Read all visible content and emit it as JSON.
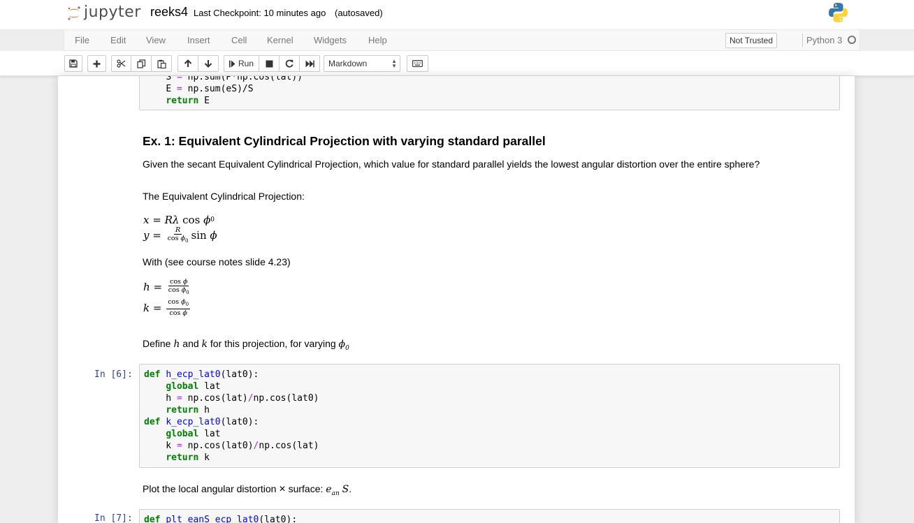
{
  "header": {
    "logo_text": "jupyter",
    "notebook_name": "reeks4",
    "checkpoint": "Last Checkpoint: 10 minutes ago",
    "autosave": "(autosaved)",
    "python_logo_icon": "python-logo-icon"
  },
  "menubar": {
    "items": [
      "File",
      "Edit",
      "View",
      "Insert",
      "Cell",
      "Kernel",
      "Widgets",
      "Help"
    ],
    "trust_label": "Not Trusted",
    "kernel_name": "Python 3",
    "kernel_indicator_icon": "kernel-idle-circle-icon"
  },
  "toolbar": {
    "run_label": "Run",
    "cell_type": "Markdown",
    "icons": [
      "save-icon",
      "plus-icon",
      "scissors-icon",
      "copy-icon",
      "paste-icon",
      "arrow-up-icon",
      "arrow-down-icon",
      "run-icon",
      "stop-icon",
      "restart-icon",
      "fast-forward-icon",
      "keyboard-icon"
    ]
  },
  "cells": {
    "top_code_tail": [
      {
        "var": "S",
        "expr": "np.sum(P*np.cos(lat))"
      },
      {
        "var": "E",
        "expr": "np.sum(eS)/S"
      },
      {
        "kw": "return",
        "rest": "E"
      }
    ],
    "ex1_heading": "Ex. 1: Equivalent Cylindrical Projection with varying standard parallel",
    "ex1_question": "Given the secant Equivalent Cylindrical Projection, which value for standard parallel yields the lowest angular distortion over the entire sphere?",
    "projection_intro": "The Equivalent Cylindrical Projection:",
    "with_notes": "With (see course notes slide 4.23)",
    "define_text_a": "Define",
    "define_text_b": "and",
    "define_text_c": "for this projection, for varying",
    "cell6_prompt": "In [6]:",
    "cell6_funcs": [
      "h_ecp_lat0",
      "k_ecp_lat0"
    ],
    "plot_text_a": "Plot the local angular distortion",
    "plot_text_b": "surface:",
    "cell7_prompt": "In [7]:",
    "cell7_func": "plt_eanS_ecp_lat0"
  },
  "colors": {
    "keyword": "#008000",
    "function_name": "#0000ff",
    "operator": "#aa22ff",
    "prompt": "#303f9f",
    "jupyter_orange": "#f37626"
  }
}
